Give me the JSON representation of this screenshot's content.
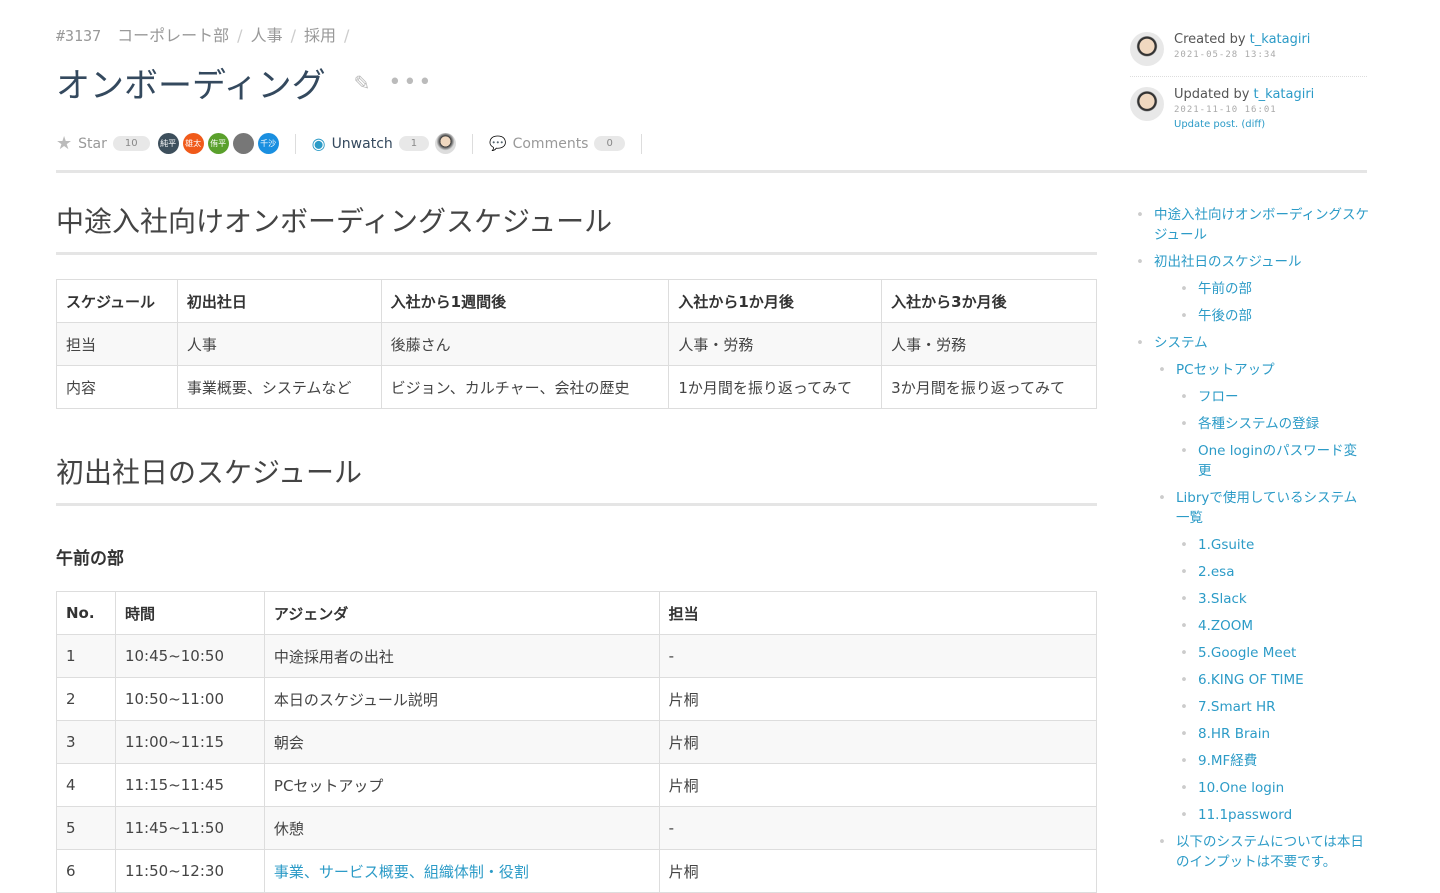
{
  "header": {
    "number": "#3137",
    "breadcrumbs": [
      "コーポレート部",
      "人事",
      "採用"
    ],
    "title": "オンボーディング",
    "star_label": "Star",
    "star_count": "10",
    "stargazers": [
      {
        "label": "純平",
        "color": "#3d4f5c"
      },
      {
        "label": "雄太",
        "color": "#f05a1a"
      },
      {
        "label": "侑平",
        "color": "#5aa02c"
      },
      {
        "label": "",
        "color": "#777"
      },
      {
        "label": "千沙",
        "color": "#1a8fe0"
      }
    ],
    "watch_label": "Unwatch",
    "watch_count": "1",
    "comments_label": "Comments",
    "comments_count": "0"
  },
  "meta": {
    "created_prefix": "Created by ",
    "created_user": "t_katagiri",
    "created_at": "2021-05-28 13:34",
    "updated_prefix": "Updated by ",
    "updated_user": "t_katagiri",
    "updated_at": "2021-11-10 16:01",
    "update_message": "Update post. (diff)"
  },
  "sections": {
    "h1": "中途入社向けオンボーディングスケジュール",
    "h2": "初出社日のスケジュール",
    "h3": "午前の部"
  },
  "table1": {
    "headers": [
      "スケジュール",
      "初出社日",
      "入社から1週間後",
      "入社から1か月後",
      "入社から3か月後"
    ],
    "rows": [
      [
        "担当",
        "人事",
        "後藤さん",
        "人事・労務",
        "人事・労務"
      ],
      [
        "内容",
        "事業概要、システムなど",
        "ビジョン、カルチャー、会社の歴史",
        "1か月間を振り返ってみて",
        "3か月間を振り返ってみて"
      ]
    ]
  },
  "table2": {
    "headers": [
      "No.",
      "時間",
      "アジェンダ",
      "担当"
    ],
    "rows": [
      [
        "1",
        "10:45~10:50",
        "中途採用者の出社",
        "-"
      ],
      [
        "2",
        "10:50~11:00",
        "本日のスケジュール説明",
        "片桐"
      ],
      [
        "3",
        "11:00~11:15",
        "朝会",
        "片桐"
      ],
      [
        "4",
        "11:15~11:45",
        "PCセットアップ",
        "片桐"
      ],
      [
        "5",
        "11:45~11:50",
        "休憩",
        "-"
      ],
      [
        "6",
        "11:50~12:30",
        "事業、サービス概要、組織体制・役割",
        "片桐"
      ]
    ]
  },
  "toc": [
    {
      "label": "中途入社向けオンボーディングスケジュール",
      "level": 1
    },
    {
      "label": "初出社日のスケジュール",
      "level": 1
    },
    {
      "label": "午前の部",
      "level": 3
    },
    {
      "label": "午後の部",
      "level": 3
    },
    {
      "label": "システム",
      "level": 1
    },
    {
      "label": "PCセットアップ",
      "level": 2
    },
    {
      "label": "フロー",
      "level": 3
    },
    {
      "label": "各種システムの登録",
      "level": 3
    },
    {
      "label": "One loginのパスワード変更",
      "level": 3
    },
    {
      "label": "Libryで使用しているシステム一覧",
      "level": 2
    },
    {
      "label": "1.Gsuite",
      "level": 3
    },
    {
      "label": "2.esa",
      "level": 3
    },
    {
      "label": "3.Slack",
      "level": 3
    },
    {
      "label": "4.ZOOM",
      "level": 3
    },
    {
      "label": "5.Google Meet",
      "level": 3
    },
    {
      "label": "6.KING OF TIME",
      "level": 3
    },
    {
      "label": "7.Smart HR",
      "level": 3
    },
    {
      "label": "8.HR Brain",
      "level": 3
    },
    {
      "label": "9.MF経費",
      "level": 3
    },
    {
      "label": "10.One login",
      "level": 3
    },
    {
      "label": "11.1password",
      "level": 3
    },
    {
      "label": "以下のシステムについては本日のインプットは不要です。",
      "level": 2
    }
  ]
}
